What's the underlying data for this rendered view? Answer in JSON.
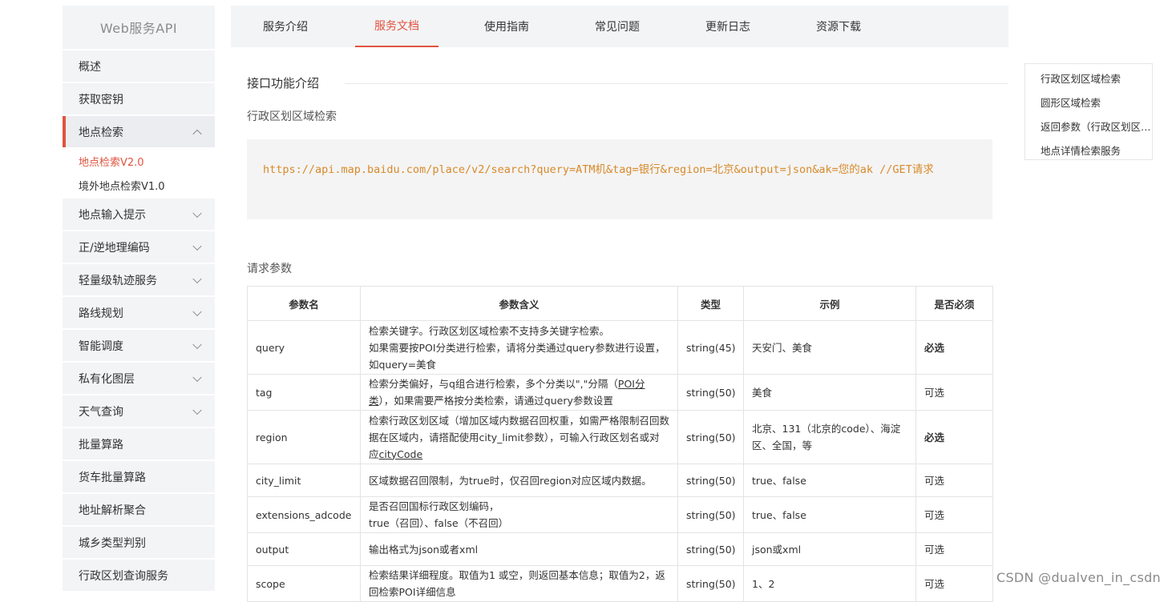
{
  "sidebar": {
    "title": "Web服务API",
    "items": [
      {
        "label": "概述",
        "chevron": "none"
      },
      {
        "label": "获取密钥",
        "chevron": "none"
      },
      {
        "label": "地点检索",
        "chevron": "up",
        "active": true,
        "children": [
          {
            "label": "地点检索V2.0",
            "current": true
          },
          {
            "label": "境外地点检索V1.0",
            "current": false
          }
        ]
      },
      {
        "label": "地点输入提示",
        "chevron": "down"
      },
      {
        "label": "正/逆地理编码",
        "chevron": "down"
      },
      {
        "label": "轻量级轨迹服务",
        "chevron": "down"
      },
      {
        "label": "路线规划",
        "chevron": "down"
      },
      {
        "label": "智能调度",
        "chevron": "down"
      },
      {
        "label": "私有化图层",
        "chevron": "down"
      },
      {
        "label": "天气查询",
        "chevron": "down"
      },
      {
        "label": "批量算路",
        "chevron": "none"
      },
      {
        "label": "货车批量算路",
        "chevron": "none"
      },
      {
        "label": "地址解析聚合",
        "chevron": "none"
      },
      {
        "label": "城乡类型判别",
        "chevron": "none"
      },
      {
        "label": "行政区划查询服务",
        "chevron": "none"
      }
    ]
  },
  "tabs": [
    {
      "label": "服务介绍",
      "active": false
    },
    {
      "label": "服务文档",
      "active": true
    },
    {
      "label": "使用指南",
      "active": false
    },
    {
      "label": "常见问题",
      "active": false
    },
    {
      "label": "更新日志",
      "active": false
    },
    {
      "label": "资源下载",
      "active": false
    }
  ],
  "content": {
    "section_heading": "接口功能介绍",
    "subsection": "行政区划区域检索",
    "code": "https://api.map.baidu.com/place/v2/search?query=ATM机&tag=银行&region=北京&output=json&ak=您的ak //GET请求",
    "request_params_title": "请求参数",
    "table": {
      "headers": [
        "参数名",
        "参数含义",
        "类型",
        "示例",
        "是否必须"
      ],
      "rows": [
        {
          "name": "query",
          "meaning": "检索关键字。行政区划区域检索不支持多关键字检索。\n如果需要按POI分类进行检索，请将分类通过query参数进行设置，如query=美食",
          "type": "string(45)",
          "example": "天安门、美食",
          "required": "必选"
        },
        {
          "name": "tag",
          "meaning_pre": "检索分类偏好，与q组合进行检索，多个分类以\",\"分隔（",
          "meaning_link": "POI分类",
          "meaning_post": "），如果需要严格按分类检索，请通过query参数设置",
          "type": "string(50)",
          "example": "美食",
          "required": "可选"
        },
        {
          "name": "region",
          "meaning_pre": "检索行政区划区域（增加区域内数据召回权重，如需严格限制召回数据在区域内，请搭配使用city_limit参数），可输入行政区划名或对应",
          "meaning_link": "cityCode",
          "meaning_post": "",
          "type": "string(50)",
          "example": "北京、131（北京的code）、海淀区、全国，等",
          "required": "必选"
        },
        {
          "name": "city_limit",
          "meaning": "区域数据召回限制，为true时，仅召回region对应区域内数据。",
          "type": "string(50)",
          "example": "true、false",
          "required": "可选"
        },
        {
          "name": "extensions_adcode",
          "meaning": "是否召回国标行政区划编码，\ntrue（召回）、false（不召回）",
          "type": "string(50)",
          "example": "true、false",
          "required": "可选"
        },
        {
          "name": "output",
          "meaning": "输出格式为json或者xml",
          "type": "string(50)",
          "example": "json或xml",
          "required": "可选"
        },
        {
          "name": "scope",
          "meaning": "检索结果详细程度。取值为1 或空，则返回基本信息；取值为2，返回检索POI详细信息",
          "type": "string(50)",
          "example": "1、2",
          "required": "可选"
        }
      ]
    }
  },
  "toc": [
    "行政区划区域检索",
    "圆形区域检索",
    "返回参数（行政区划区域检索）",
    "地点详情检索服务"
  ],
  "watermark": "CSDN @dualven_in_csdn",
  "colors": {
    "accent": "#e0533f",
    "code": "#d88a2b",
    "panel": "#f3f4f6"
  }
}
